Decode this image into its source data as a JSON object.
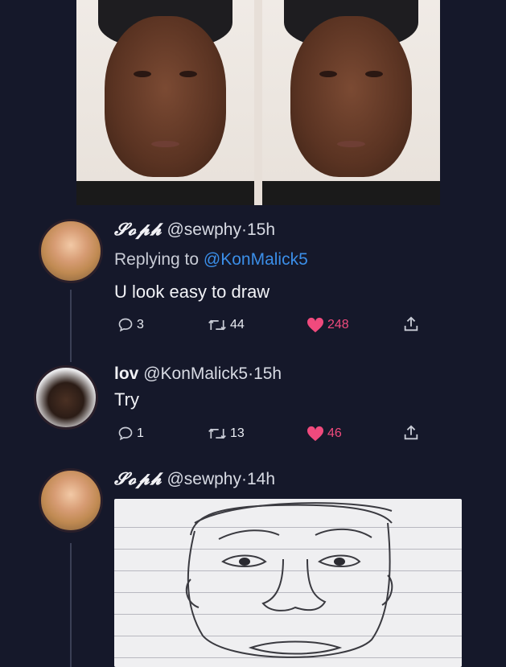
{
  "tweets": [
    {
      "name": "𝓢𝓸𝓹𝓱",
      "handle": "@sewphy",
      "time": "15h",
      "reply_prefix": "Replying to",
      "reply_to": "@KonMalick5",
      "text": "U look easy to draw",
      "replies": "3",
      "retweets": "44",
      "likes": "248"
    },
    {
      "name": "lov",
      "handle": "@KonMalick5",
      "time": "15h",
      "text": "Try",
      "replies": "1",
      "retweets": "13",
      "likes": "46"
    },
    {
      "name": "𝓢𝓸𝓹𝓱",
      "handle": "@sewphy",
      "time": "14h"
    }
  ],
  "separator": "·",
  "colors": {
    "background": "#15182a",
    "mention": "#3b8ee8",
    "like": "#f04a7d"
  },
  "icons": [
    "reply-icon",
    "retweet-icon",
    "heart-icon",
    "share-icon"
  ]
}
